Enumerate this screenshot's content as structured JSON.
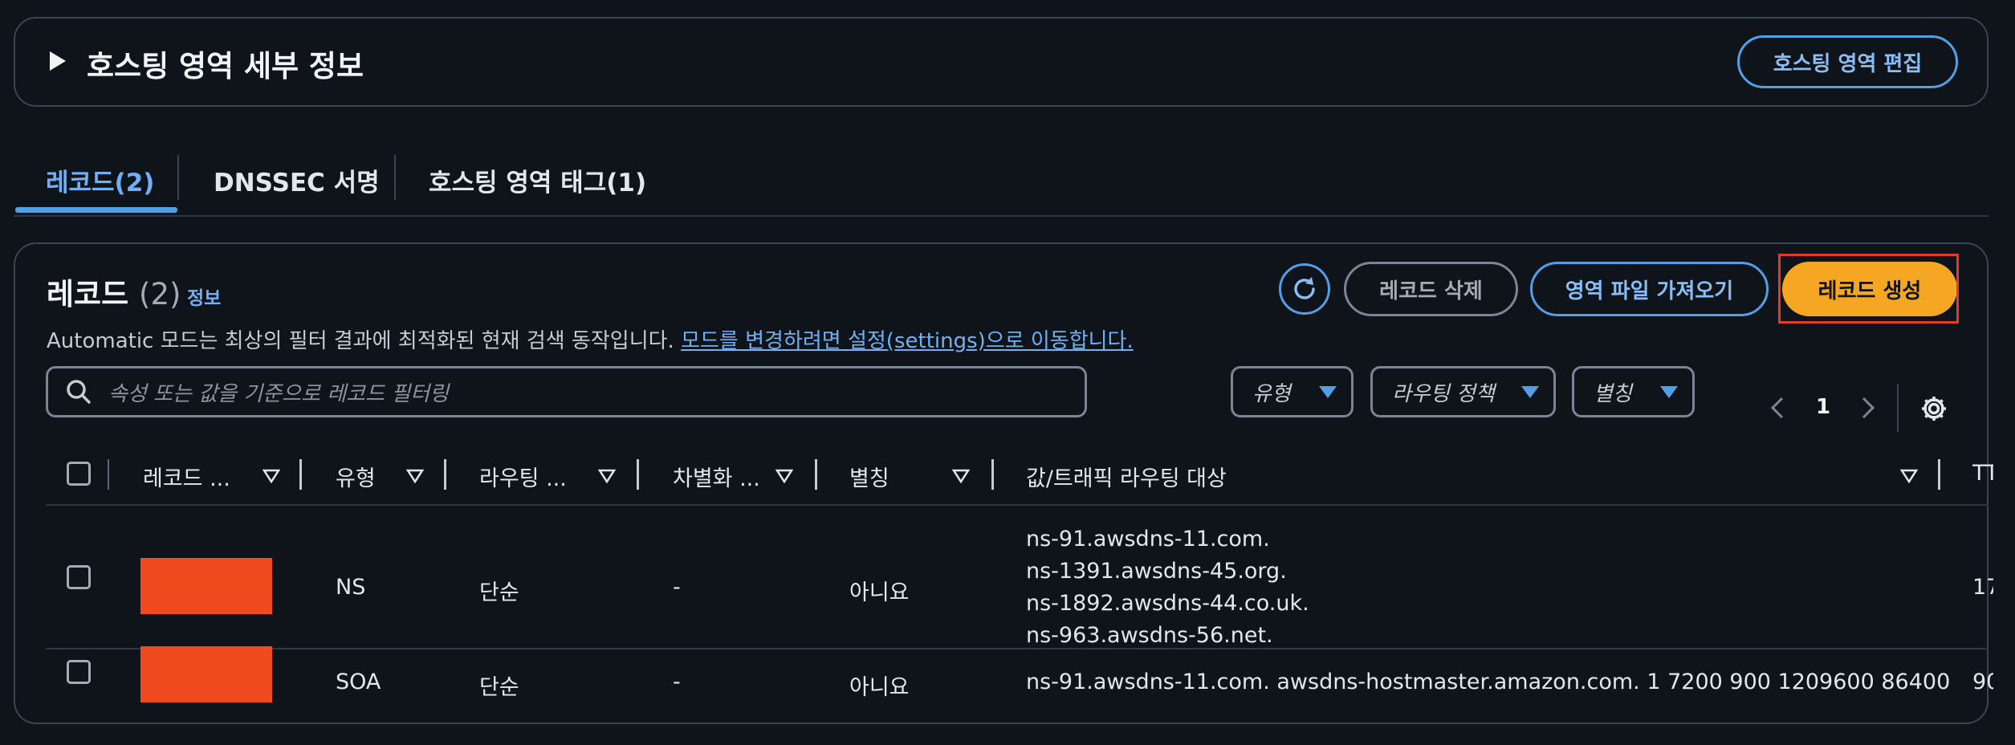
{
  "detail_panel": {
    "title": "호스팅 영역 세부 정보",
    "edit_button": "호스팅 영역 편집"
  },
  "tabs": [
    {
      "label": "레코드(2)",
      "active": true
    },
    {
      "label": "DNSSEC 서명",
      "active": false
    },
    {
      "label": "호스팅 영역 태그(1)",
      "active": false
    }
  ],
  "records": {
    "title": "레코드",
    "count": "(2)",
    "info_link": "정보",
    "description": "Automatic 모드는 최상의 필터 결과에 최적화된 현재 검색 동작입니다.",
    "description_link": "모드를 변경하려면 설정(settings)으로 이동합니다.",
    "delete_button": "레코드 삭제",
    "import_button": "영역 파일 가져오기",
    "create_button": "레코드 생성",
    "search_placeholder": "속성 또는 값을 기준으로 레코드 필터링",
    "filters": [
      "유형",
      "라우팅 정책",
      "별칭"
    ],
    "page": "1",
    "columns": [
      "레코드 ...",
      "유형",
      "라우팅 ...",
      "차별화 ...",
      "별칭",
      "값/트래픽 라우팅 대상",
      "TT"
    ],
    "rows": [
      {
        "type": "NS",
        "routing": "단순",
        "differentiator": "-",
        "alias": "아니요",
        "values": [
          "ns-91.awsdns-11.com.",
          "ns-1391.awsdns-45.org.",
          "ns-1892.awsdns-44.co.uk.",
          "ns-963.awsdns-56.net."
        ],
        "ttl": "17"
      },
      {
        "type": "SOA",
        "routing": "단순",
        "differentiator": "-",
        "alias": "아니요",
        "values": [
          "ns-91.awsdns-11.com. awsdns-hostmaster.amazon.com. 1 7200 900 1209600 86400"
        ],
        "ttl": "90"
      }
    ]
  },
  "colors": {
    "background": "#0f141b",
    "accent_blue": "#539fe5",
    "primary_orange": "#f5a623",
    "redaction": "#f04a1f",
    "highlight_red": "#e23b2a"
  }
}
